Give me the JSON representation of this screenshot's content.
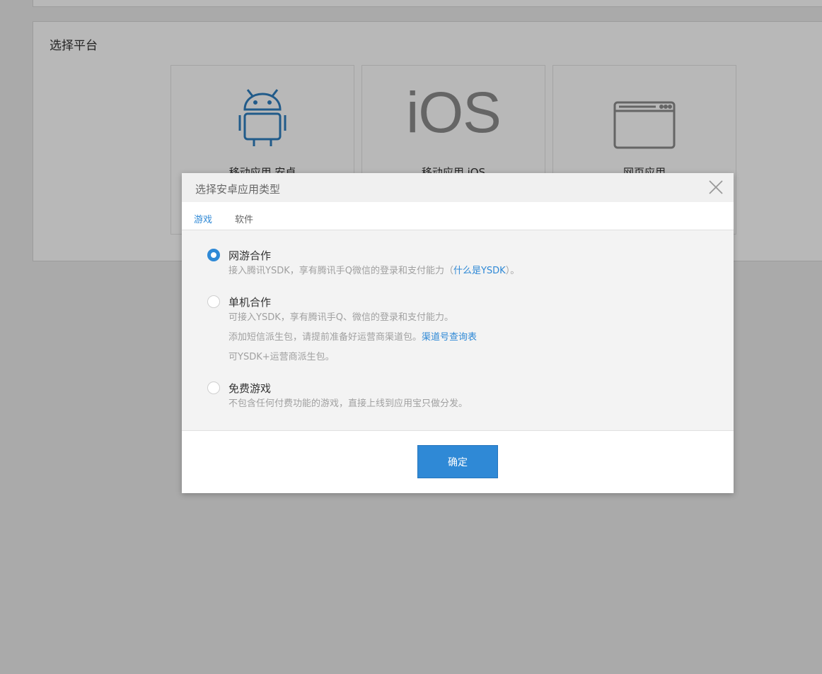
{
  "platform": {
    "title": "选择平台",
    "cards": [
      {
        "label": "移动应用 安卓",
        "icon": "android-icon"
      },
      {
        "label": "移动应用 iOS",
        "icon": "ios-logo-icon",
        "logo_text": "iOS"
      },
      {
        "label": "网页应用",
        "icon": "browser-window-icon"
      }
    ]
  },
  "modal": {
    "title": "选择安卓应用类型",
    "tabs": [
      {
        "label": "游戏",
        "active": true
      },
      {
        "label": "软件",
        "active": false
      }
    ],
    "options": [
      {
        "title": "网游合作",
        "checked": true,
        "desc_prefix": "接入腾讯YSDK，享有腾讯手Q微信的登录和支付能力（",
        "desc_link": "什么是YSDK",
        "desc_suffix": "）。"
      },
      {
        "title": "单机合作",
        "checked": false,
        "line1": "可接入YSDK，享有腾讯手Q、微信的登录和支付能力。",
        "line2_prefix": "添加短信派生包，请提前准备好运营商渠道包。",
        "line2_link": "渠道号查询表",
        "line3": "可YSDK+运营商派生包。"
      },
      {
        "title": "免费游戏",
        "checked": false,
        "desc": "不包含任何付费功能的游戏，直接上线到应用宝只做分发。"
      }
    ],
    "confirm_label": "确定"
  },
  "colors": {
    "accent": "#2f89d6",
    "android_blue": "#2f7fc0"
  }
}
